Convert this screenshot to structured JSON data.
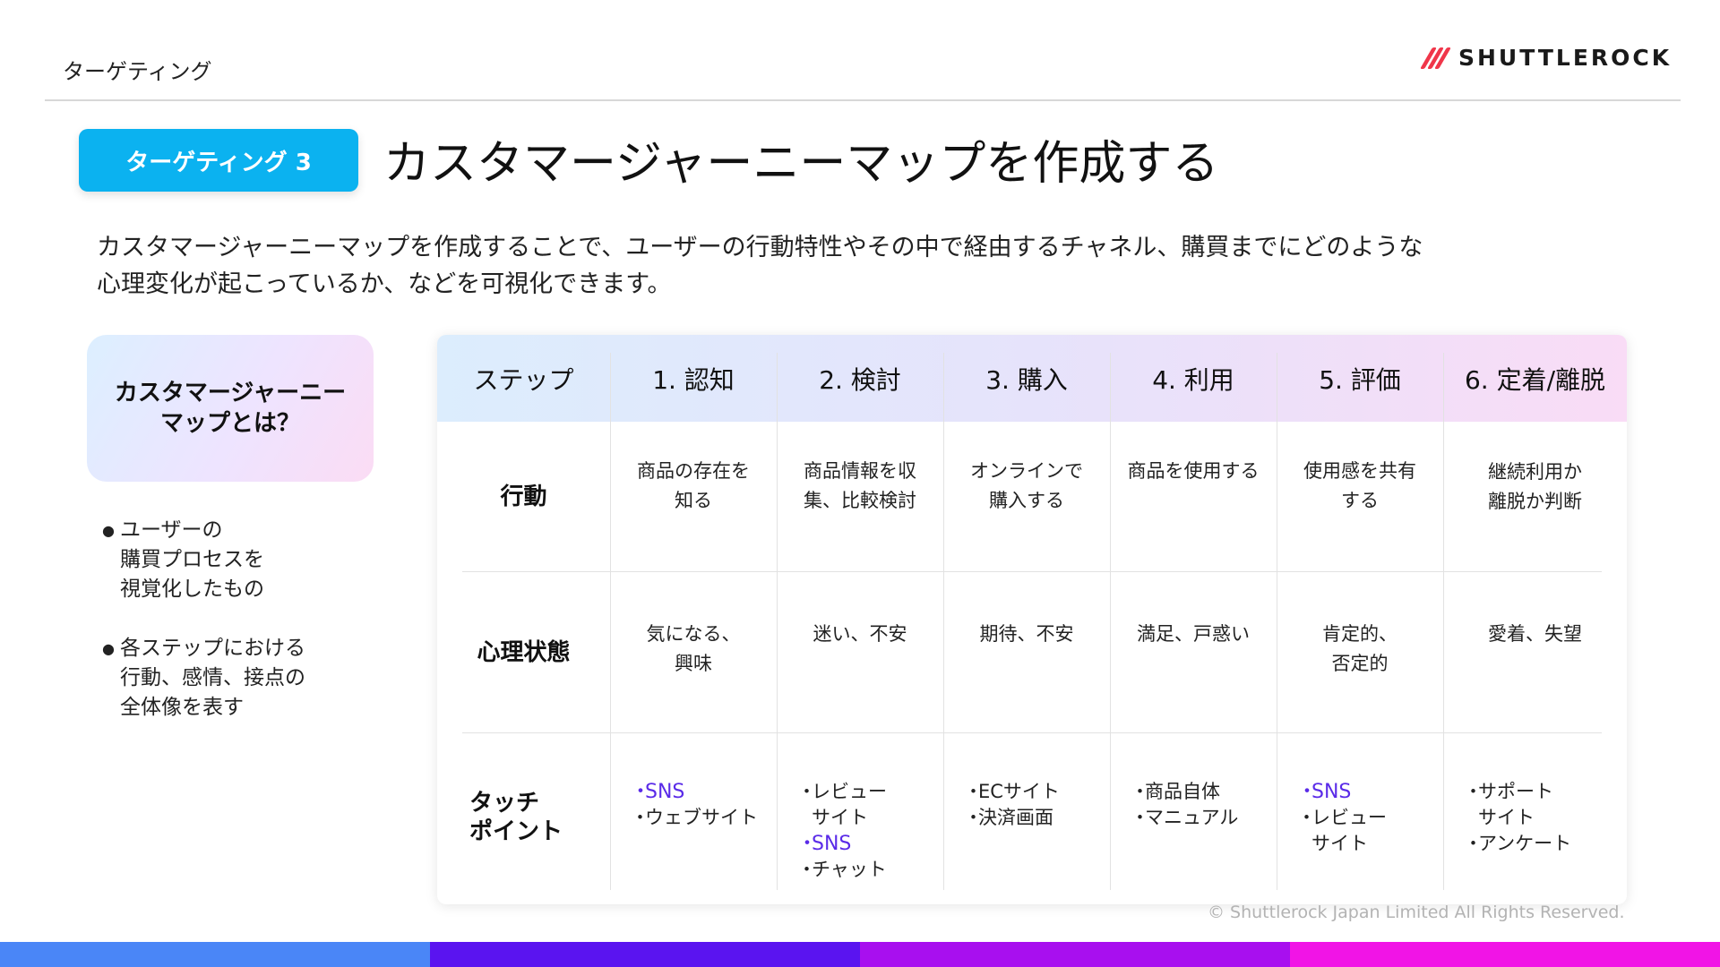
{
  "header": {
    "section_label": "ターゲティング",
    "logo_text": "SHUTTLEROCK",
    "logo_color": "#f0364a"
  },
  "badge": {
    "label": "ターゲティング 3",
    "color": "#0bb2f0"
  },
  "title": "カスタマージャーニーマップを作成する",
  "description": [
    "カスタマージャーニーマップを作成することで、ユーザーの行動特性やその中で経由するチャネル、購買までにどのような",
    "心理変化が起こっているか、などを可視化できます。"
  ],
  "side": {
    "card_title_lines": [
      "カスタマージャーニー",
      "マップとは？"
    ],
    "bullets": [
      [
        "ユーザーの",
        "購買プロセスを",
        "視覚化したもの"
      ],
      [
        "各ステップにおける",
        "行動、感情、接点の",
        "全体像を表す"
      ]
    ]
  },
  "table": {
    "header_label": "ステップ",
    "steps": [
      "1. 認知",
      "2. 検討",
      "3. 購入",
      "4. 利用",
      "5. 評価",
      "6. 定着/離脱"
    ],
    "rows": [
      {
        "label_lines": [
          "行動"
        ],
        "cells": [
          [
            "商品の存在を",
            "知る"
          ],
          [
            "商品情報を収",
            "集、比較検討"
          ],
          [
            "オンラインで",
            "購入する"
          ],
          [
            "商品を使用する"
          ],
          [
            "使用感を共有",
            "する"
          ],
          [
            "継続利用か",
            "離脱か判断"
          ]
        ]
      },
      {
        "label_lines": [
          "心理状態"
        ],
        "cells": [
          [
            "気になる、",
            "興味"
          ],
          [
            "迷い、不安"
          ],
          [
            "期待、不安"
          ],
          [
            "満足、戸惑い"
          ],
          [
            "肯定的、",
            "否定的"
          ],
          [
            "愛着、失望"
          ]
        ]
      }
    ],
    "touchpoint_label_lines": [
      "タッチ",
      "ポイント"
    ],
    "touchpoints": [
      [
        {
          "text": "SNS",
          "accent": true
        },
        {
          "text": "ウェブサイト",
          "accent": false
        }
      ],
      [
        {
          "text": "レビュー",
          "accent": false
        },
        {
          "text": "サイト",
          "accent": false,
          "cont": true
        },
        {
          "text": "SNS",
          "accent": true
        },
        {
          "text": "チャット",
          "accent": false
        }
      ],
      [
        {
          "text": "ECサイト",
          "accent": false
        },
        {
          "text": "決済画面",
          "accent": false
        }
      ],
      [
        {
          "text": "商品自体",
          "accent": false
        },
        {
          "text": "マニュアル",
          "accent": false
        }
      ],
      [
        {
          "text": "SNS",
          "accent": true
        },
        {
          "text": "レビュー",
          "accent": false
        },
        {
          "text": "サイト",
          "accent": false,
          "cont": true
        }
      ],
      [
        {
          "text": "サポート",
          "accent": false
        },
        {
          "text": "サイト",
          "accent": false,
          "cont": true
        },
        {
          "text": "アンケート",
          "accent": false
        }
      ]
    ],
    "accent_color": "#5a2be8"
  },
  "footer": {
    "copyright": "© Shuttlerock Japan Limited All Rights Reserved.",
    "bar_colors": [
      "#4a86f7",
      "#5a14f0",
      "#a80fef",
      "#f114e6"
    ]
  }
}
